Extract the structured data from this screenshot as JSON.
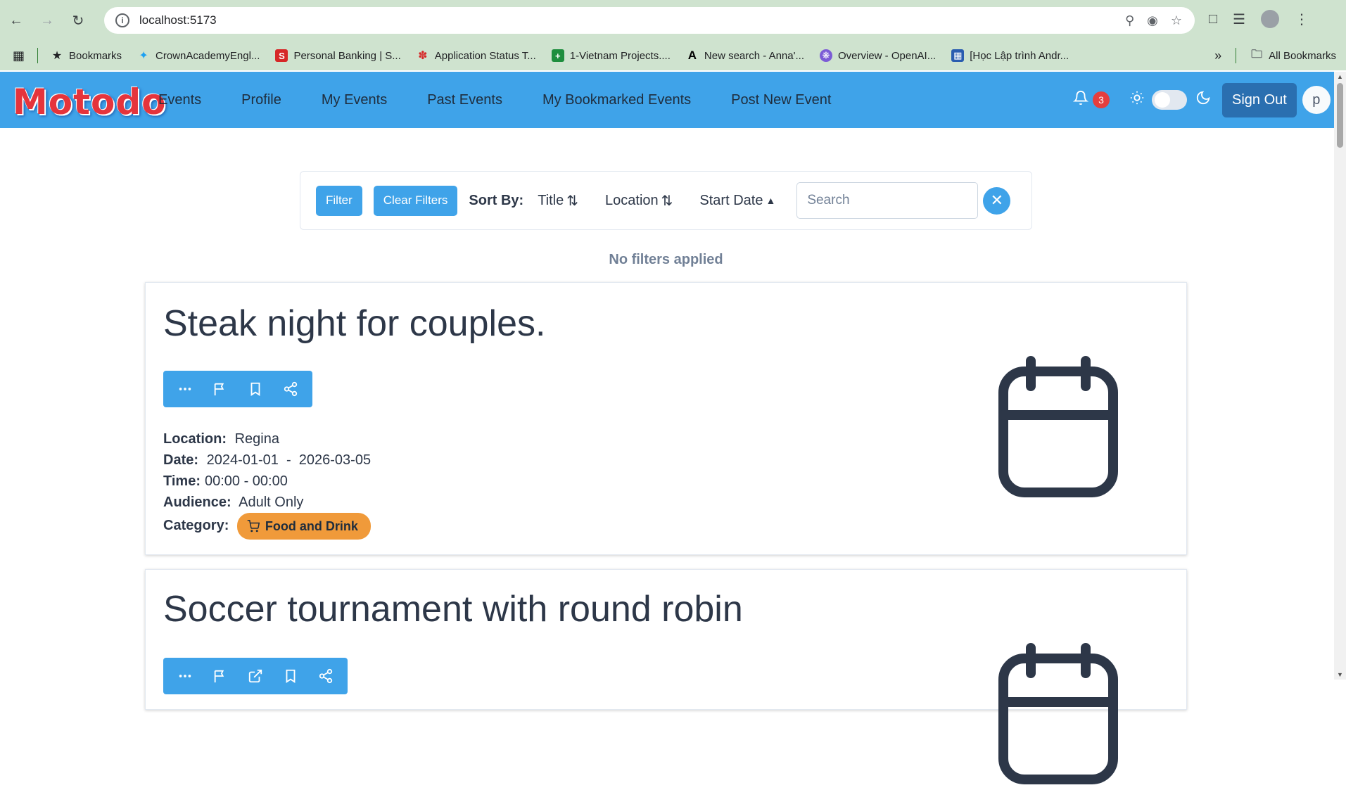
{
  "browser": {
    "url": "localhost:5173",
    "bookmarks": [
      {
        "label": "Bookmarks",
        "icon": "star-icon"
      },
      {
        "label": "CrownAcademyEngl...",
        "icon": "twitter-icon"
      },
      {
        "label": "Personal Banking | S...",
        "icon": "bank-icon"
      },
      {
        "label": "Application Status T...",
        "icon": "maple-leaf-icon"
      },
      {
        "label": "1-Vietnam Projects....",
        "icon": "sheets-icon"
      },
      {
        "label": "New search - Anna'...",
        "icon": "anna-icon"
      },
      {
        "label": "Overview - OpenAI...",
        "icon": "openai-icon"
      },
      {
        "label": "[Học Lập trình Andr...",
        "icon": "grid-icon"
      }
    ],
    "all_bookmarks": "All Bookmarks"
  },
  "navbar": {
    "logo": "Motodo",
    "links": [
      "Events",
      "Profile",
      "My Events",
      "Past Events",
      "My Bookmarked Events",
      "Post New Event"
    ],
    "notification_count": "3",
    "sign_out": "Sign Out",
    "user_initial": "p"
  },
  "filters": {
    "filter_label": "Filter",
    "clear_label": "Clear Filters",
    "sort_by": "Sort By:",
    "sort_title": "Title",
    "sort_location": "Location",
    "sort_start_date": "Start Date",
    "search_placeholder": "Search",
    "status": "No filters applied"
  },
  "events": [
    {
      "title": "Steak night for couples.",
      "location_label": "Location:",
      "location": "Regina",
      "date_label": "Date:",
      "date": "2024-01-01  -  2026-03-05",
      "time_label": "Time:",
      "time": "00:00 - 00:00",
      "audience_label": "Audience:",
      "audience": "Adult Only",
      "category_label": "Category:",
      "category": "Food and Drink"
    },
    {
      "title": "Soccer tournament with round robin"
    }
  ],
  "colors": {
    "navbar": "#3fa3e9",
    "sign_out": "#2a6fb0",
    "badge": "#e53e3e",
    "category_food": "#f09a3a",
    "text": "#2d3748"
  }
}
